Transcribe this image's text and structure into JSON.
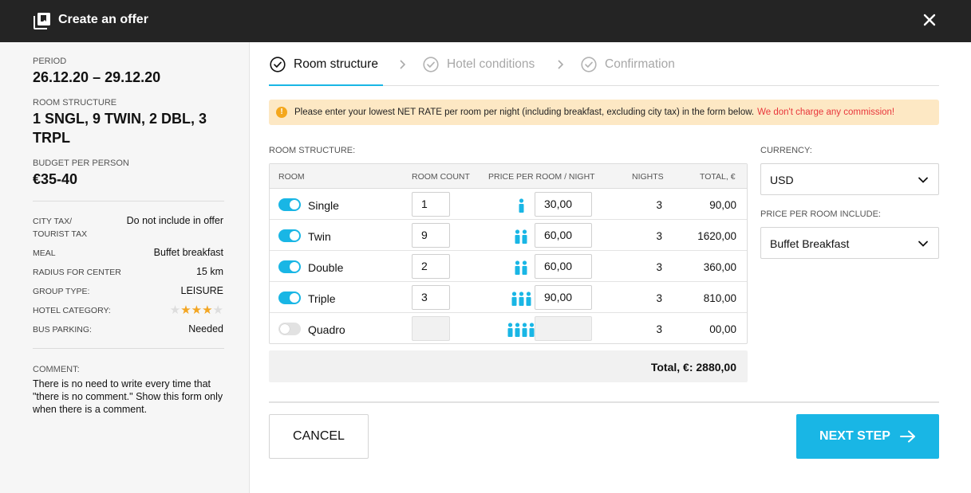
{
  "header": {
    "title": "Create an offer",
    "logo_icon": "copy-stack-icon",
    "close_icon": "close-icon"
  },
  "sidebar": {
    "period_label": "PERIOD",
    "period_value": "26.12.20 – 29.12.20",
    "room_structure_label": "ROOM STRUCTURE",
    "room_structure_line1": "1 SNGL,  9 TWIN,  2 DBL, 3",
    "room_structure_line2": "TRPL",
    "budget_label": "BUDGET PER PERSON",
    "budget_value": "€35-40",
    "details": {
      "city_tax_label_1": "CITY TAX/",
      "city_tax_label_2": "TOURIST TAX",
      "city_tax_value": "Do not include in offer",
      "meal_label": "MEAL",
      "meal_value": "Buffet breakfast",
      "radius_label": "RADIUS FOR CENTER",
      "radius_value": "15 km",
      "group_type_label": "GROUP TYPE:",
      "group_type_value": "LEISURE",
      "hotel_category_label": "HOTEL CATEGORY:",
      "hotel_category_stars": 3,
      "hotel_category_max": 5,
      "bus_parking_label": "BUS PARKING:",
      "bus_parking_value": "Needed"
    },
    "comment_label": "COMMENT:",
    "comment_text": "There is no need to write every time that \"there is no comment.\" Show this form only when there is a comment."
  },
  "steps": [
    {
      "label": "Room structure",
      "state": "active"
    },
    {
      "label": "Hotel conditions",
      "state": "inactive"
    },
    {
      "label": "Confirmation",
      "state": "inactive"
    }
  ],
  "notice": {
    "text": "Please enter your lowest NET RATE per room per night (including breakfast, excluding city tax) in the form below.",
    "highlight": "We don't charge any commission!",
    "icon": "warning-icon"
  },
  "room_structure_label": "ROOM STRUCTURE:",
  "table": {
    "headers": {
      "room": "ROOM",
      "count": "ROOM COUNT",
      "price": "PRICE PER ROOM / NIGHT",
      "nights": "NIGHTS",
      "total": "TOTAL, €"
    },
    "rows": [
      {
        "name": "Single",
        "enabled": true,
        "count": "1",
        "people": 1,
        "price": "30,00",
        "nights": "3",
        "total": "90,00"
      },
      {
        "name": "Twin",
        "enabled": true,
        "count": "9",
        "people": 2,
        "price": "60,00",
        "nights": "3",
        "total": "1620,00"
      },
      {
        "name": "Double",
        "enabled": true,
        "count": "2",
        "people": 2,
        "price": "60,00",
        "nights": "3",
        "total": "360,00"
      },
      {
        "name": "Triple",
        "enabled": true,
        "count": "3",
        "people": 3,
        "price": "90,00",
        "nights": "3",
        "total": "810,00"
      },
      {
        "name": "Quadro",
        "enabled": false,
        "count": "",
        "people": 4,
        "price": "",
        "nights": "3",
        "total": "00,00"
      }
    ],
    "total": "Total, €: 2880,00"
  },
  "currency": {
    "label": "CURRENCY:",
    "value": "USD"
  },
  "price_include": {
    "label": "PRICE PER ROOM INCLUDE:",
    "value": "Buffet Breakfast"
  },
  "buttons": {
    "cancel": "CANCEL",
    "next": "NEXT STEP"
  },
  "colors": {
    "accent": "#19b6e5",
    "star": "#f3a623",
    "notice_bg": "#fde8c4",
    "notice_red": "#e8363b",
    "topbar": "#242424"
  }
}
